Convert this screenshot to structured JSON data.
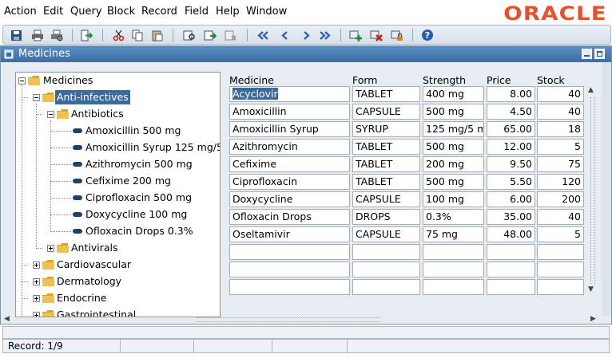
{
  "menu": [
    "Action",
    "Edit",
    "Query",
    "Block",
    "Record",
    "Field",
    "Help",
    "Window"
  ],
  "brand": "ORACLE",
  "colors": {
    "brand": "#e8502b",
    "titlebar": "#4a7db5",
    "selection": "#3d6a9a",
    "background": "#e7ecf2"
  },
  "toolbar": {
    "icons": [
      "save-icon",
      "print-icon",
      "print-setup-icon",
      "exit-icon",
      "cut-icon",
      "copy-icon",
      "paste-icon",
      "enter-query-icon",
      "execute-query-icon",
      "cancel-query-icon",
      "first-record-icon",
      "previous-record-icon",
      "next-record-icon",
      "last-record-icon",
      "insert-record-icon",
      "delete-record-icon",
      "lock-record-icon",
      "help-icon"
    ]
  },
  "window": {
    "title": "Medicines"
  },
  "tree": {
    "root": "Medicines",
    "cat_anti": "Anti-infectives",
    "sub_antibiotics": "Antibiotics",
    "leaves": [
      "Amoxicillin 500 mg",
      "Amoxicillin Syrup 125 mg/5",
      "Azithromycin 500 mg",
      "Cefixime 200 mg",
      "Ciprofloxacin 500 mg",
      "Doxycycline 100 mg",
      "Ofloxacin Drops 0.3%"
    ],
    "sub_antivirals": "Antivirals",
    "categories": [
      "Cardiovascular",
      "Dermatology",
      "Endocrine"
    ],
    "partial": "Gastrointestinal"
  },
  "grid": {
    "headers": {
      "medicine": "Medicine",
      "form": "Form",
      "strength": "Strength",
      "price": "Price",
      "stock": "Stock"
    },
    "rows": [
      {
        "medicine": "Acyclovir",
        "form": "TABLET",
        "strength": "400 mg",
        "price": "8.00",
        "stock": "40"
      },
      {
        "medicine": "Amoxicillin",
        "form": "CAPSULE",
        "strength": "500 mg",
        "price": "4.50",
        "stock": "40"
      },
      {
        "medicine": "Amoxicillin Syrup",
        "form": "SYRUP",
        "strength": "125 mg/5 m",
        "price": "65.00",
        "stock": "18"
      },
      {
        "medicine": "Azithromycin",
        "form": "TABLET",
        "strength": "500 mg",
        "price": "12.00",
        "stock": "5"
      },
      {
        "medicine": "Cefixime",
        "form": "TABLET",
        "strength": "200 mg",
        "price": "9.50",
        "stock": "75"
      },
      {
        "medicine": "Ciprofloxacin",
        "form": "TABLET",
        "strength": "500 mg",
        "price": "5.50",
        "stock": "120"
      },
      {
        "medicine": "Doxycycline",
        "form": "CAPSULE",
        "strength": "100 mg",
        "price": "6.00",
        "stock": "200"
      },
      {
        "medicine": "Ofloxacin Drops",
        "form": "DROPS",
        "strength": "0.3%",
        "price": "35.00",
        "stock": "40"
      },
      {
        "medicine": "Oseltamivir",
        "form": "CAPSULE",
        "strength": "75 mg",
        "price": "48.00",
        "stock": "5"
      }
    ]
  },
  "status": {
    "record": "Record: 1/9"
  }
}
